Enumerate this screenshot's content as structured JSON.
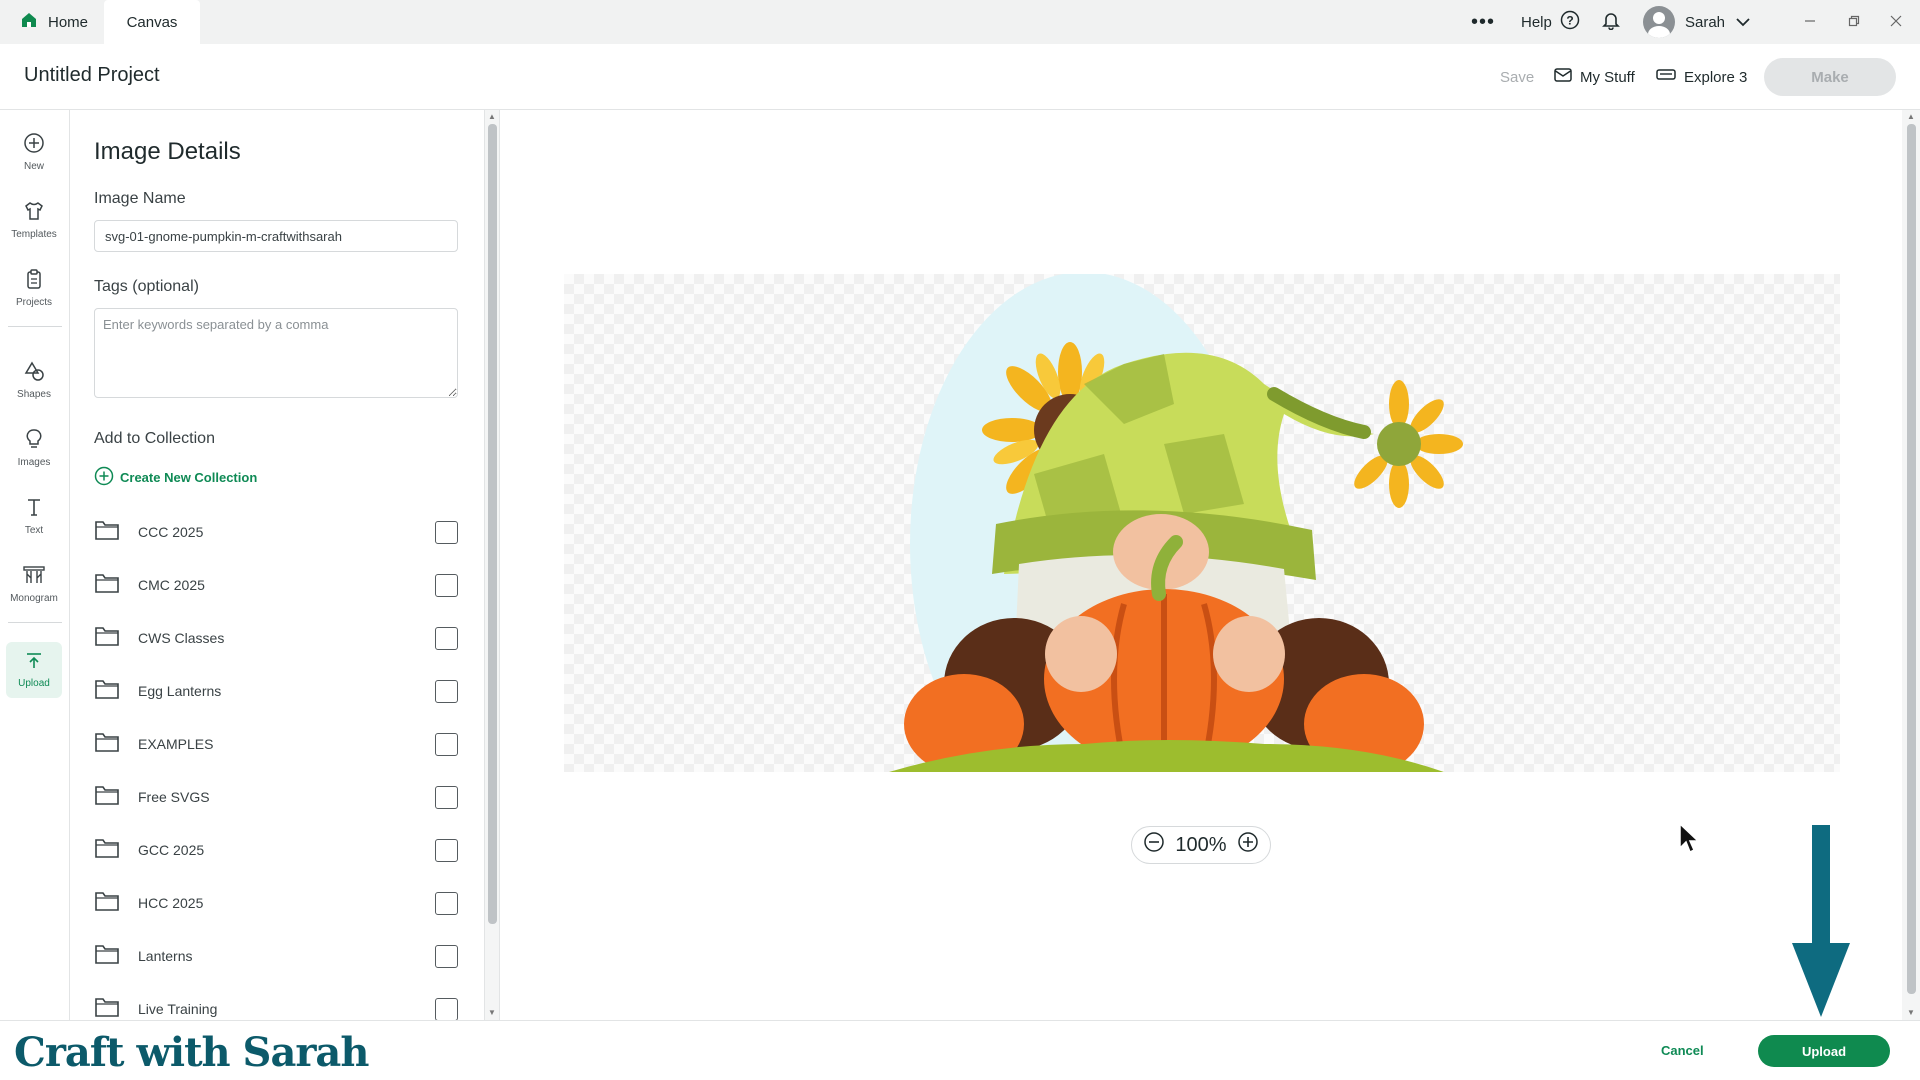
{
  "tabs": {
    "home": "Home",
    "canvas": "Canvas"
  },
  "topbar": {
    "more": "•••",
    "help": "Help",
    "user": "Sarah"
  },
  "header": {
    "project_title": "Untitled Project",
    "save": "Save",
    "my_stuff": "My Stuff",
    "machine": "Explore 3",
    "make": "Make"
  },
  "rail": {
    "new": "New",
    "templates": "Templates",
    "projects": "Projects",
    "shapes": "Shapes",
    "images": "Images",
    "text": "Text",
    "monogram": "Monogram",
    "upload": "Upload"
  },
  "panel": {
    "title": "Image Details",
    "image_name_label": "Image Name",
    "image_name_value": "svg-01-gnome-pumpkin-m-craftwithsarah",
    "tags_label": "Tags (optional)",
    "tags_placeholder": "Enter keywords separated by a comma",
    "collection_label": "Add to Collection",
    "create_collection": "Create New Collection",
    "collections": [
      "CCC 2025",
      "CMC 2025",
      "CWS Classes",
      "Egg Lanterns",
      "EXAMPLES",
      "Free SVGS",
      "GCC 2025",
      "HCC 2025",
      "Lanterns",
      "Live Training"
    ]
  },
  "zoom": {
    "level": "100%"
  },
  "footer": {
    "brand": "Craft with Sarah",
    "cancel": "Cancel",
    "upload": "Upload"
  },
  "colors": {
    "accent_green": "#0f8a4f",
    "brand_teal": "#0c5a6a",
    "arrow_teal": "#0e6b80"
  }
}
